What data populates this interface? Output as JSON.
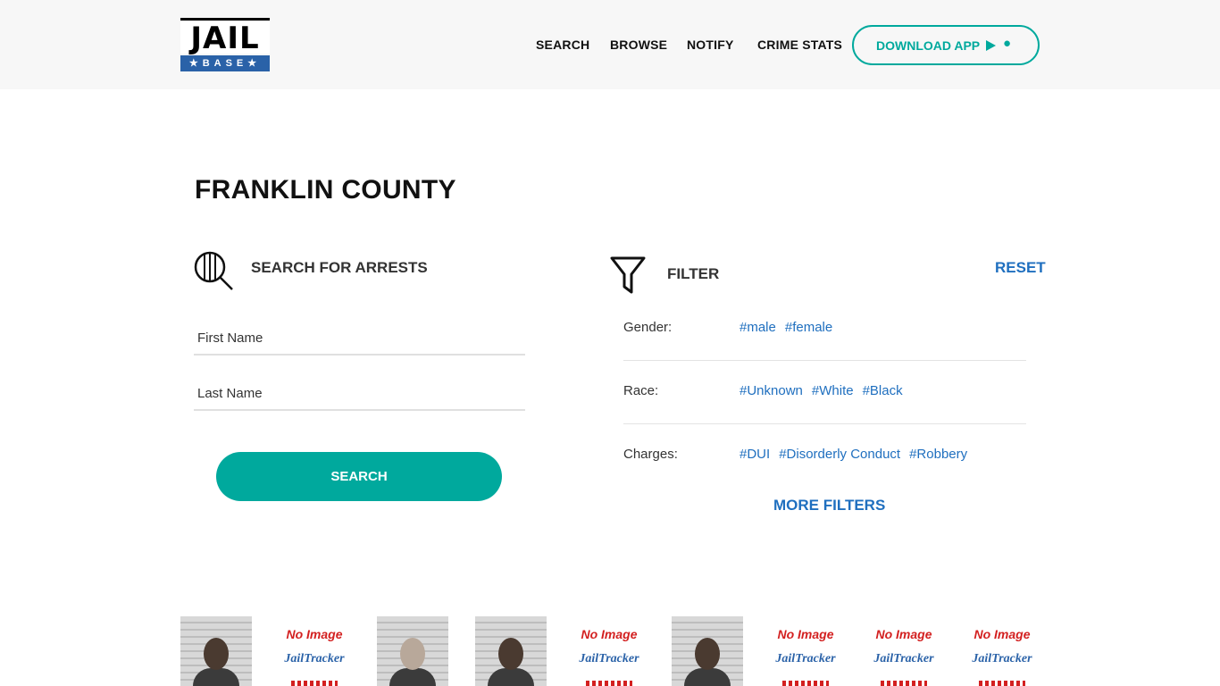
{
  "header": {
    "logo_top": "JAIL",
    "logo_bottom": "★BASE★",
    "nav": [
      "SEARCH",
      "BROWSE",
      "NOTIFY",
      "CRIME STATS"
    ],
    "download_label": "DOWNLOAD APP"
  },
  "page": {
    "title": "FRANKLIN COUNTY"
  },
  "search": {
    "heading": "SEARCH FOR ARRESTS",
    "first_name_placeholder": "First Name",
    "last_name_placeholder": "Last Name",
    "button": "SEARCH"
  },
  "filter": {
    "heading": "FILTER",
    "reset": "RESET",
    "rows": [
      {
        "label": "Gender:",
        "tags": [
          "#male",
          "#female"
        ]
      },
      {
        "label": "Race:",
        "tags": [
          "#Unknown",
          "#White",
          "#Black"
        ]
      },
      {
        "label": "Charges:",
        "tags": [
          "#DUI",
          "#Disorderly Conduct",
          "#Robbery"
        ]
      }
    ],
    "more": "MORE FILTERS"
  },
  "thumbnails": {
    "no_image_title": "No Image",
    "no_image_brand": "JailTracker",
    "items": [
      "photo",
      "noimage",
      "photo",
      "photo",
      "noimage",
      "photo",
      "noimage",
      "noimage",
      "noimage"
    ]
  },
  "colors": {
    "accent": "#00a99d",
    "link": "#1f6fbf",
    "logo_blue": "#2a62a8"
  }
}
